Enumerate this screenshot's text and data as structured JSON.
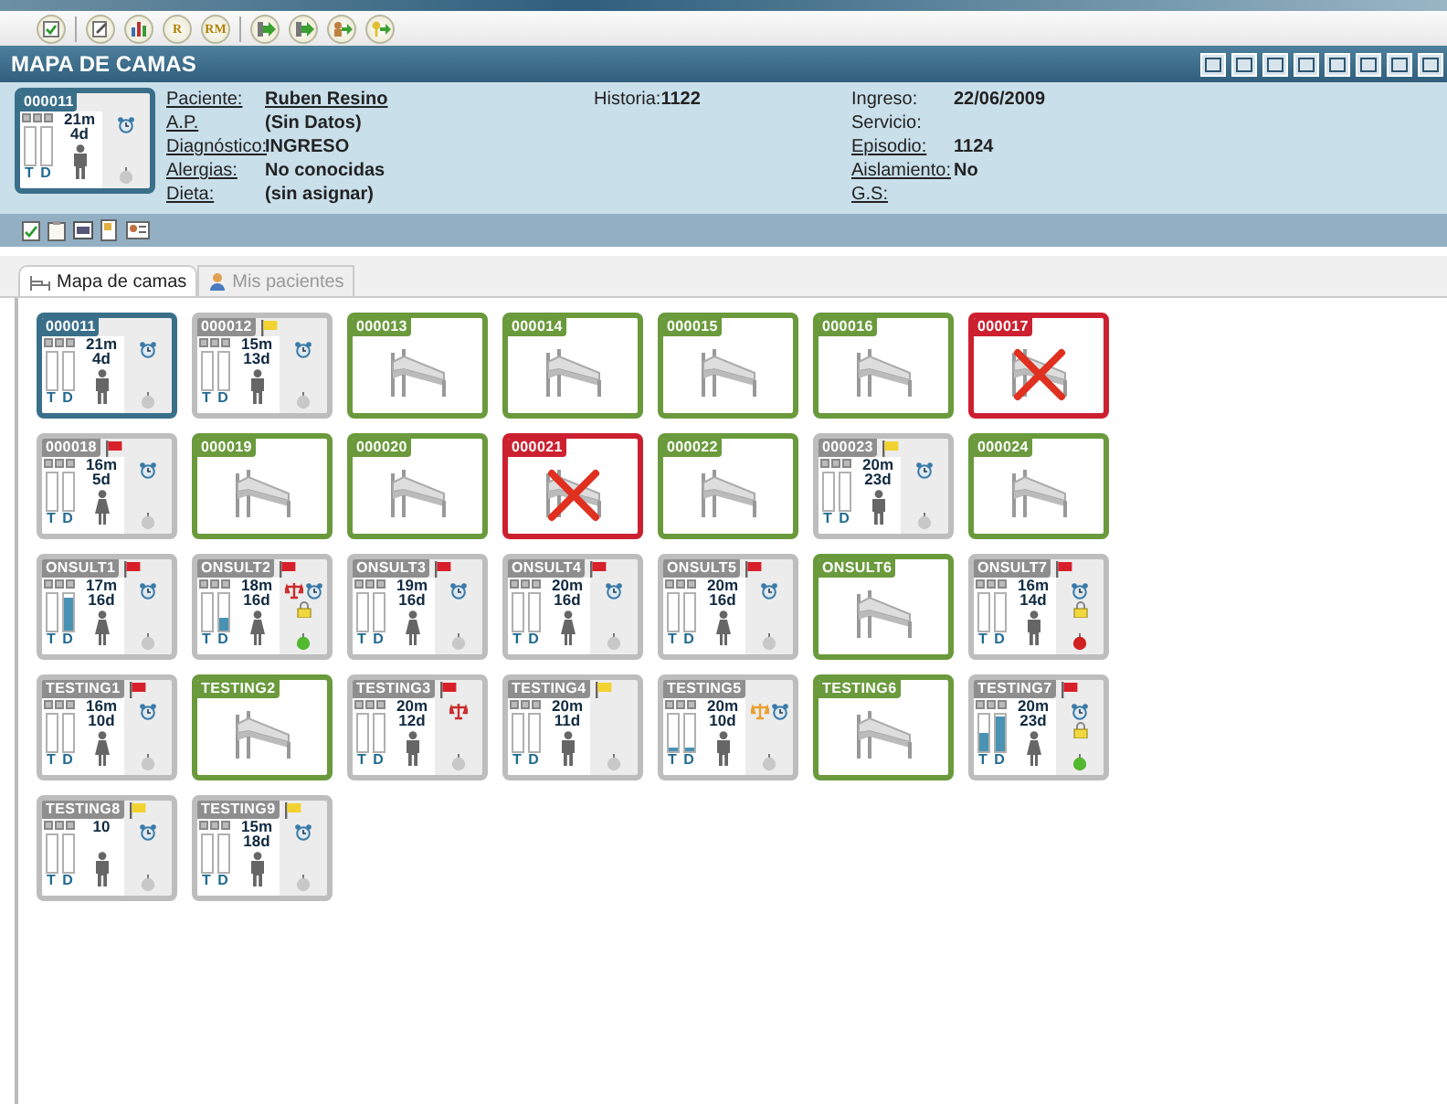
{
  "toolbar": [
    {
      "kind": "check"
    },
    {
      "kind": "edit"
    },
    {
      "kind": "chart"
    },
    {
      "kind": "letter",
      "text": "R"
    },
    {
      "kind": "letter",
      "text": "RM"
    },
    {
      "kind": "arrow"
    },
    {
      "kind": "arrow"
    },
    {
      "kind": "person-arrow"
    },
    {
      "kind": "key-arrow"
    }
  ],
  "title": "MAPA DE CAMAS",
  "patient": {
    "tile": {
      "kind": "occupied",
      "code": "000011",
      "selected": true,
      "time": [
        "21m",
        "4d"
      ],
      "bars": [
        {
          "label": "T",
          "level": 0
        },
        {
          "label": "D",
          "level": 0
        }
      ],
      "female": false,
      "alarm": true,
      "lock": false,
      "apple": {
        "color": "#c8c8c8"
      }
    },
    "left": [
      {
        "label": "Paciente:",
        "value": "Ruben Resino",
        "link": true,
        "value_link": true
      },
      {
        "label": "A.P.",
        "value": "(Sin Datos)",
        "link": true,
        "value_link": false
      },
      {
        "label": "Diagnóstico:",
        "value": "INGRESO",
        "link": true,
        "value_link": false
      },
      {
        "label": "Alergias:",
        "value": "No conocidas",
        "link": true,
        "value_link": false
      },
      {
        "label": "Dieta:",
        "value": "(sin asignar)",
        "link": true,
        "value_link": false
      }
    ],
    "middle": [
      {
        "label": "Historia:",
        "value": "1122",
        "link": false,
        "value_link": false
      }
    ],
    "right": [
      {
        "label": "Ingreso:",
        "value": "22/06/2009",
        "link": false,
        "value_link": false
      },
      {
        "label": "Servicio:",
        "link": false
      },
      {
        "label": "Episodio:",
        "value": "1124",
        "link": true,
        "value_link": false
      },
      {
        "label": "Aislamiento:",
        "value": "No",
        "link": true,
        "value_link": false
      },
      {
        "label": "G.S:",
        "link": true
      }
    ]
  },
  "tabs": [
    {
      "label": "Mapa de camas",
      "selected": true
    },
    {
      "label": "Mis pacientes",
      "selected": false
    }
  ],
  "beds": [
    {
      "kind": "occupied",
      "code": "000011",
      "selected": true,
      "time": [
        "21m",
        "4d"
      ],
      "bars": [
        {
          "label": "T",
          "level": 0
        },
        {
          "label": "D",
          "level": 0
        }
      ],
      "female": false,
      "alarm": true,
      "lock": false,
      "apple": {
        "color": "#c8c8c8"
      }
    },
    {
      "kind": "occupied",
      "code": "000012",
      "selected": false,
      "flag": {
        "color": "#f2d230"
      },
      "time": [
        "15m",
        "13d"
      ],
      "bars": [
        {
          "label": "T",
          "level": 0
        },
        {
          "label": "D",
          "level": 0
        }
      ],
      "female": false,
      "alarm": true,
      "lock": false,
      "apple": {
        "color": "#c8c8c8"
      }
    },
    {
      "kind": "free",
      "code": "000013"
    },
    {
      "kind": "free",
      "code": "000014"
    },
    {
      "kind": "free",
      "code": "000015"
    },
    {
      "kind": "free",
      "code": "000016"
    },
    {
      "kind": "blocked",
      "code": "000017"
    },
    {
      "kind": "occupied",
      "code": "000018",
      "selected": false,
      "flag": {
        "color": "#d8202a"
      },
      "time": [
        "16m",
        "5d"
      ],
      "bars": [
        {
          "label": "T",
          "level": 0
        },
        {
          "label": "D",
          "level": 0
        }
      ],
      "female": true,
      "alarm": true,
      "lock": false,
      "apple": {
        "color": "#c8c8c8"
      }
    },
    {
      "kind": "free",
      "code": "000019"
    },
    {
      "kind": "free",
      "code": "000020"
    },
    {
      "kind": "blocked",
      "code": "000021"
    },
    {
      "kind": "free",
      "code": "000022"
    },
    {
      "kind": "occupied",
      "code": "000023",
      "selected": false,
      "flag": {
        "color": "#f2d230"
      },
      "time": [
        "20m",
        "23d"
      ],
      "bars": [
        {
          "label": "T",
          "level": 0
        },
        {
          "label": "D",
          "level": 0
        }
      ],
      "female": false,
      "alarm": true,
      "lock": false,
      "apple": {
        "color": "#c8c8c8"
      }
    },
    {
      "kind": "free",
      "code": "000024"
    },
    {
      "kind": "occupied",
      "code": "ONSULT1",
      "selected": false,
      "flag": {
        "color": "#d8202a"
      },
      "time": [
        "17m",
        "16d"
      ],
      "bars": [
        {
          "label": "T",
          "level": 0
        },
        {
          "label": "D",
          "level": 0.9
        }
      ],
      "female": true,
      "alarm": true,
      "lock": false,
      "apple": {
        "color": "#c8c8c8"
      }
    },
    {
      "kind": "occupied",
      "code": "ONSULT2",
      "selected": false,
      "flag": {
        "color": "#d8202a"
      },
      "time": [
        "18m",
        "16d"
      ],
      "bars": [
        {
          "label": "T",
          "level": 0
        },
        {
          "label": "D",
          "level": 0.35
        }
      ],
      "female": true,
      "alarm": true,
      "scale": {
        "color": "#cc2a2a"
      },
      "lock": true,
      "apple": {
        "color": "#52b830"
      }
    },
    {
      "kind": "occupied",
      "code": "ONSULT3",
      "selected": false,
      "flag": {
        "color": "#d8202a"
      },
      "time": [
        "19m",
        "16d"
      ],
      "bars": [
        {
          "label": "T",
          "level": 0
        },
        {
          "label": "D",
          "level": 0
        }
      ],
      "female": true,
      "alarm": true,
      "lock": false,
      "apple": {
        "color": "#c8c8c8"
      }
    },
    {
      "kind": "occupied",
      "code": "ONSULT4",
      "selected": false,
      "flag": {
        "color": "#d8202a"
      },
      "time": [
        "20m",
        "16d"
      ],
      "bars": [
        {
          "label": "T",
          "level": 0
        },
        {
          "label": "D",
          "level": 0
        }
      ],
      "female": true,
      "alarm": true,
      "lock": false,
      "apple": {
        "color": "#c8c8c8"
      }
    },
    {
      "kind": "occupied",
      "code": "ONSULT5",
      "selected": false,
      "flag": {
        "color": "#d8202a"
      },
      "time": [
        "20m",
        "16d"
      ],
      "bars": [
        {
          "label": "T",
          "level": 0
        },
        {
          "label": "D",
          "level": 0
        }
      ],
      "female": true,
      "alarm": true,
      "lock": false,
      "apple": {
        "color": "#c8c8c8"
      }
    },
    {
      "kind": "free",
      "code": "ONSULT6"
    },
    {
      "kind": "occupied",
      "code": "ONSULT7",
      "selected": false,
      "flag": {
        "color": "#d8202a"
      },
      "time": [
        "16m",
        "14d"
      ],
      "bars": [
        {
          "label": "T",
          "level": 0
        },
        {
          "label": "D",
          "level": 0
        }
      ],
      "female": false,
      "alarm": true,
      "lock": true,
      "apple": {
        "color": "#d02020"
      }
    },
    {
      "kind": "occupied",
      "code": "TESTING1",
      "selected": false,
      "flag": {
        "color": "#d8202a"
      },
      "time": [
        "16m",
        "10d"
      ],
      "bars": [
        {
          "label": "T",
          "level": 0
        },
        {
          "label": "D",
          "level": 0
        }
      ],
      "female": true,
      "alarm": true,
      "lock": false,
      "apple": {
        "color": "#c8c8c8"
      }
    },
    {
      "kind": "free",
      "code": "TESTING2"
    },
    {
      "kind": "occupied",
      "code": "TESTING3",
      "selected": false,
      "flag": {
        "color": "#d8202a"
      },
      "time": [
        "20m",
        "12d"
      ],
      "bars": [
        {
          "label": "T",
          "level": 0
        },
        {
          "label": "D",
          "level": 0
        }
      ],
      "female": false,
      "alarm": false,
      "scale": {
        "color": "#cc2a2a"
      },
      "lock": false,
      "apple": {
        "color": "#c8c8c8"
      }
    },
    {
      "kind": "occupied",
      "code": "TESTING4",
      "selected": false,
      "flag": {
        "color": "#f2d230"
      },
      "time": [
        "20m",
        "11d"
      ],
      "bars": [
        {
          "label": "T",
          "level": 0
        },
        {
          "label": "D",
          "level": 0
        }
      ],
      "female": false,
      "alarm": false,
      "lock": false,
      "apple": {
        "color": "#c8c8c8"
      }
    },
    {
      "kind": "occupied",
      "code": "TESTING5",
      "selected": false,
      "time": [
        "20m",
        "10d"
      ],
      "bars": [
        {
          "label": "T",
          "level": 0.1
        },
        {
          "label": "D",
          "level": 0.1
        }
      ],
      "female": false,
      "alarm": true,
      "scale": {
        "color": "#e8a030"
      },
      "lock": false,
      "apple": {
        "color": "#c8c8c8"
      }
    },
    {
      "kind": "free",
      "code": "TESTING6"
    },
    {
      "kind": "occupied",
      "code": "TESTING7",
      "selected": false,
      "flag": {
        "color": "#d8202a"
      },
      "time": [
        "20m",
        "23d"
      ],
      "bars": [
        {
          "label": "T",
          "level": 0.5
        },
        {
          "label": "D",
          "level": 0.95
        }
      ],
      "female": true,
      "alarm": true,
      "lock": true,
      "apple": {
        "color": "#52b830"
      }
    },
    {
      "kind": "occupied",
      "code": "TESTING8",
      "selected": false,
      "flag": {
        "color": "#f2d230"
      },
      "time": [
        "10"
      ],
      "bars": [
        {
          "label": "T",
          "level": 0
        },
        {
          "label": "D",
          "level": 0
        }
      ],
      "female": false,
      "alarm": true,
      "lock": false,
      "apple": {
        "color": "#c8c8c8"
      }
    },
    {
      "kind": "occupied",
      "code": "TESTING9",
      "selected": false,
      "flag": {
        "color": "#f2d230"
      },
      "time": [
        "15m",
        "18d"
      ],
      "bars": [
        {
          "label": "T",
          "level": 0
        },
        {
          "label": "D",
          "level": 0
        }
      ],
      "female": false,
      "alarm": true,
      "lock": false,
      "apple": {
        "color": "#c8c8c8"
      }
    }
  ]
}
